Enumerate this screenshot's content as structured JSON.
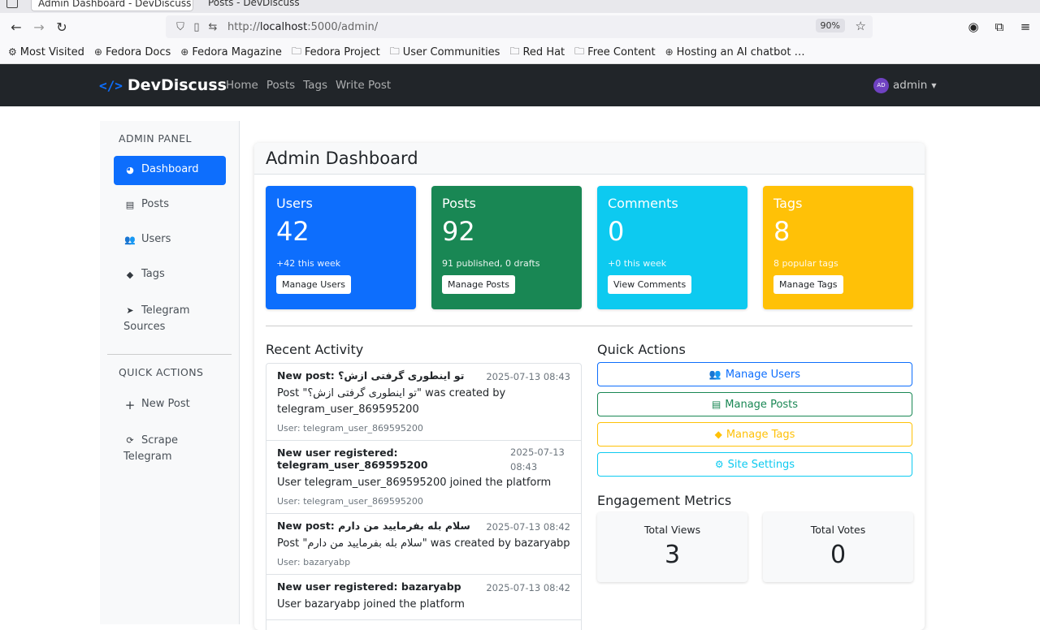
{
  "browser": {
    "tab_active": "Admin Dashboard - DevDiscuss",
    "tab_other": "Posts - DevDiscuss",
    "url_prefix": "http://",
    "url_host": "localhost",
    "url_rest": ":5000/admin/",
    "zoom": "90%",
    "bookmarks": [
      {
        "icon": "gear-icon",
        "label": "Most Visited"
      },
      {
        "icon": "globe-icon",
        "label": "Fedora Docs"
      },
      {
        "icon": "globe-icon",
        "label": "Fedora Magazine"
      },
      {
        "icon": "folder-icon",
        "label": "Fedora Project"
      },
      {
        "icon": "folder-icon",
        "label": "User Communities"
      },
      {
        "icon": "folder-icon",
        "label": "Red Hat"
      },
      {
        "icon": "folder-icon",
        "label": "Free Content"
      },
      {
        "icon": "globe-icon",
        "label": "Hosting an AI chatbot …"
      }
    ]
  },
  "nav": {
    "brand": "DevDiscuss",
    "links": [
      "Home",
      "Posts",
      "Tags",
      "Write Post"
    ],
    "avatar_initials": "AD",
    "username": "admin"
  },
  "sidebar": {
    "heading": "ADMIN PANEL",
    "items": [
      {
        "label": "Dashboard",
        "icon": "gauge-icon"
      },
      {
        "label": "Posts",
        "icon": "file-icon"
      },
      {
        "label": "Users",
        "icon": "users-icon"
      },
      {
        "label": "Tags",
        "icon": "tags-icon"
      },
      {
        "label": "Telegram Sources",
        "icon": "telegram-icon"
      }
    ],
    "quick_heading": "QUICK ACTIONS",
    "quick_items": [
      {
        "label": "New Post",
        "icon": "plus-icon"
      },
      {
        "label": "Scrape Telegram",
        "icon": "sync-icon"
      }
    ]
  },
  "main": {
    "title": "Admin Dashboard",
    "stats": [
      {
        "title": "Users",
        "value": "42",
        "sub": "+42 this week",
        "button": "Manage Users",
        "color": "#0d6efd"
      },
      {
        "title": "Posts",
        "value": "92",
        "sub": "91 published, 0 drafts",
        "button": "Manage Posts",
        "color": "#198754"
      },
      {
        "title": "Comments",
        "value": "0",
        "sub": "+0 this week",
        "button": "View Comments",
        "color": "#0dcaf0"
      },
      {
        "title": "Tags",
        "value": "8",
        "sub": "8 popular tags",
        "button": "Manage Tags",
        "color": "#ffc107"
      }
    ],
    "recent_activity_title": "Recent Activity",
    "activity": [
      {
        "title": "New post: تو اینطوری گرفتی ازش؟",
        "date": "2025-07-13 08:43",
        "body": "Post \"تو اینطوری گرفتی ازش؟\" was created by telegram_user_869595200",
        "user": "User: telegram_user_869595200"
      },
      {
        "title": "New user registered: telegram_user_869595200",
        "date": "2025-07-13 08:43",
        "body": "User telegram_user_869595200 joined the platform",
        "user": "User: telegram_user_869595200"
      },
      {
        "title": "New post: سلام بله بفرمایید من دارم",
        "date": "2025-07-13 08:42",
        "body": "Post \"سلام بله بفرمایید من دارم\" was created by bazaryabp",
        "user": "User: bazaryabp"
      },
      {
        "title": "New user registered: bazaryabp",
        "date": "2025-07-13 08:42",
        "body": "User bazaryabp joined the platform",
        "user": ""
      }
    ],
    "quick_actions_title": "Quick Actions",
    "quick_actions": [
      {
        "label": "Manage Users",
        "icon": "users-icon"
      },
      {
        "label": "Manage Posts",
        "icon": "file-icon"
      },
      {
        "label": "Manage Tags",
        "icon": "tags-icon"
      },
      {
        "label": "Site Settings",
        "icon": "gear-icon"
      }
    ],
    "engagement_title": "Engagement Metrics",
    "metrics": [
      {
        "label": "Total Views",
        "value": "3"
      },
      {
        "label": "Total Votes",
        "value": "0"
      }
    ]
  }
}
